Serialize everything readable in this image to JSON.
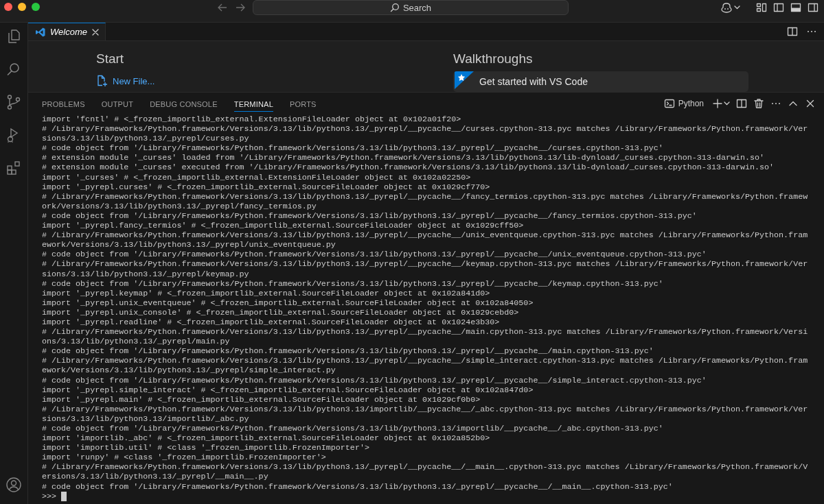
{
  "title_bar": {
    "search": {
      "placeholder": "Search"
    }
  },
  "editor": {
    "tabs": [
      {
        "label": "Welcome",
        "selected": true
      }
    ],
    "welcome": {
      "start_heading": "Start",
      "start_items": [
        "New File..."
      ],
      "walkthroughs_heading": "Walkthroughs",
      "walkthroughs": [
        "Get started with VS Code"
      ]
    }
  },
  "panel": {
    "tabs": [
      {
        "label": "PROBLEMS",
        "selected": false
      },
      {
        "label": "OUTPUT",
        "selected": false
      },
      {
        "label": "DEBUG CONSOLE",
        "selected": false
      },
      {
        "label": "TERMINAL",
        "selected": true
      },
      {
        "label": "PORTS",
        "selected": false
      }
    ],
    "terminal_profile": "Python",
    "terminal": {
      "lines": [
        "import 'fcntl' # <_frozen_importlib_external.ExtensionFileLoader object at 0x102a01f20>",
        "# /Library/Frameworks/Python.framework/Versions/3.13/lib/python3.13/_pyrepl/__pycache__/curses.cpython-313.pyc matches /Library/Frameworks/Python.framework/Ver",
        "sions/3.13/lib/python3.13/_pyrepl/curses.py",
        "# code object from '/Library/Frameworks/Python.framework/Versions/3.13/lib/python3.13/_pyrepl/__pycache__/curses.cpython-313.pyc'",
        "# extension module '_curses' loaded from '/Library/Frameworks/Python.framework/Versions/3.13/lib/python3.13/lib-dynload/_curses.cpython-313-darwin.so'",
        "# extension module '_curses' executed from '/Library/Frameworks/Python.framework/Versions/3.13/lib/python3.13/lib-dynload/_curses.cpython-313-darwin.so'",
        "import '_curses' # <_frozen_importlib_external.ExtensionFileLoader object at 0x102a02250>",
        "import '_pyrepl.curses' # <_frozen_importlib_external.SourceFileLoader object at 0x1029cf770>",
        "# /Library/Frameworks/Python.framework/Versions/3.13/lib/python3.13/_pyrepl/__pycache__/fancy_termios.cpython-313.pyc matches /Library/Frameworks/Python.framew",
        "ork/Versions/3.13/lib/python3.13/_pyrepl/fancy_termios.py",
        "# code object from '/Library/Frameworks/Python.framework/Versions/3.13/lib/python3.13/_pyrepl/__pycache__/fancy_termios.cpython-313.pyc'",
        "import '_pyrepl.fancy_termios' # <_frozen_importlib_external.SourceFileLoader object at 0x1029cff50>",
        "# /Library/Frameworks/Python.framework/Versions/3.13/lib/python3.13/_pyrepl/__pycache__/unix_eventqueue.cpython-313.pyc matches /Library/Frameworks/Python.fram",
        "ework/Versions/3.13/lib/python3.13/_pyrepl/unix_eventqueue.py",
        "# code object from '/Library/Frameworks/Python.framework/Versions/3.13/lib/python3.13/_pyrepl/__pycache__/unix_eventqueue.cpython-313.pyc'",
        "# /Library/Frameworks/Python.framework/Versions/3.13/lib/python3.13/_pyrepl/__pycache__/keymap.cpython-313.pyc matches /Library/Frameworks/Python.framework/Ver",
        "sions/3.13/lib/python3.13/_pyrepl/keymap.py",
        "# code object from '/Library/Frameworks/Python.framework/Versions/3.13/lib/python3.13/_pyrepl/__pycache__/keymap.cpython-313.pyc'",
        "import '_pyrepl.keymap' # <_frozen_importlib_external.SourceFileLoader object at 0x102a841d0>",
        "import '_pyrepl.unix_eventqueue' # <_frozen_importlib_external.SourceFileLoader object at 0x102a84050>",
        "import '_pyrepl.unix_console' # <_frozen_importlib_external.SourceFileLoader object at 0x1029cebd0>",
        "import '_pyrepl.readline' # <_frozen_importlib_external.SourceFileLoader object at 0x1024e3b30>",
        "# /Library/Frameworks/Python.framework/Versions/3.13/lib/python3.13/_pyrepl/__pycache__/main.cpython-313.pyc matches /Library/Frameworks/Python.framework/Versi",
        "ons/3.13/lib/python3.13/_pyrepl/main.py",
        "# code object from '/Library/Frameworks/Python.framework/Versions/3.13/lib/python3.13/_pyrepl/__pycache__/main.cpython-313.pyc'",
        "# /Library/Frameworks/Python.framework/Versions/3.13/lib/python3.13/_pyrepl/__pycache__/simple_interact.cpython-313.pyc matches /Library/Frameworks/Python.fram",
        "ework/Versions/3.13/lib/python3.13/_pyrepl/simple_interact.py",
        "# code object from '/Library/Frameworks/Python.framework/Versions/3.13/lib/python3.13/_pyrepl/__pycache__/simple_interact.cpython-313.pyc'",
        "import '_pyrepl.simple_interact' # <_frozen_importlib_external.SourceFileLoader object at 0x102a847d0>",
        "import '_pyrepl.main' # <_frozen_importlib_external.SourceFileLoader object at 0x1029cf0b0>",
        "# /Library/Frameworks/Python.framework/Versions/3.13/lib/python3.13/importlib/__pycache__/_abc.cpython-313.pyc matches /Library/Frameworks/Python.framework/Ver",
        "sions/3.13/lib/python3.13/importlib/_abc.py",
        "# code object from '/Library/Frameworks/Python.framework/Versions/3.13/lib/python3.13/importlib/__pycache__/_abc.cpython-313.pyc'",
        "import 'importlib._abc' # <_frozen_importlib_external.SourceFileLoader object at 0x102a852b0>",
        "import 'importlib.util' # <class '_frozen_importlib.FrozenImporter'>",
        "import 'runpy' # <class '_frozen_importlib.FrozenImporter'>",
        "# /Library/Frameworks/Python.framework/Versions/3.13/lib/python3.13/_pyrepl/__pycache__/__main__.cpython-313.pyc matches /Library/Frameworks/Python.framework/V",
        "ersions/3.13/lib/python3.13/_pyrepl/__main__.py",
        "# code object from '/Library/Frameworks/Python.framework/Versions/3.13/lib/python3.13/_pyrepl/__pycache__/__main__.cpython-313.pyc'"
      ],
      "prompt": ">>>"
    }
  }
}
